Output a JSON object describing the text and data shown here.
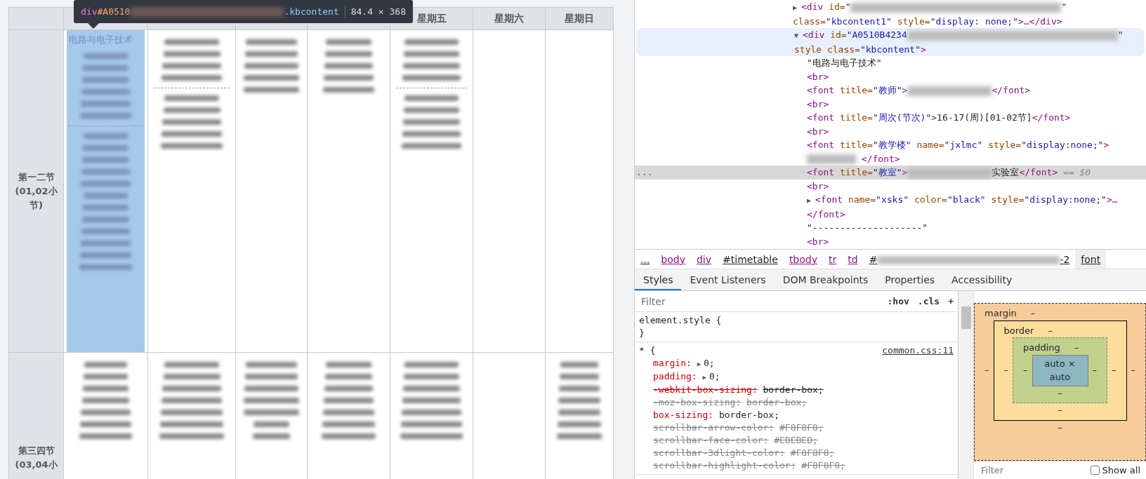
{
  "inspect_tooltip": {
    "tag": "div",
    "id_prefix": "#A0510",
    "class_name": ".kbcontent",
    "size": "84.4 × 368"
  },
  "timetable": {
    "visible_headers": [
      "星期五",
      "星期六",
      "星期日"
    ],
    "rows": [
      {
        "label": "第一二节 (01,02小节)",
        "cells": [
          {
            "kind": "double",
            "title": "电路与电子技术",
            "highlighted": true
          },
          {
            "kind": "double",
            "highlighted": false
          },
          {
            "kind": "course",
            "highlighted": false
          },
          {
            "kind": "course",
            "highlighted": false
          },
          {
            "kind": "double",
            "highlighted": false
          },
          {
            "kind": "empty",
            "highlighted": false
          },
          {
            "kind": "empty",
            "highlighted": false
          }
        ]
      },
      {
        "label": "第三四节 (03,04小",
        "cells": [
          {
            "kind": "course",
            "highlighted": false
          },
          {
            "kind": "course",
            "highlighted": false
          },
          {
            "kind": "course",
            "highlighted": false
          },
          {
            "kind": "course",
            "highlighted": false
          },
          {
            "kind": "course",
            "highlighted": false
          },
          {
            "kind": "empty",
            "highlighted": false
          },
          {
            "kind": "course",
            "highlighted": false
          }
        ]
      }
    ]
  },
  "dom_tree": [
    {
      "toggle": "▶",
      "hovered": false,
      "selected": false,
      "tokens": [
        {
          "kind": "tag",
          "text": "<div"
        },
        {
          "kind": "attr",
          "text": " id="
        },
        {
          "kind": "value",
          "text": "\""
        },
        {
          "kind": "redacted_long"
        },
        {
          "kind": "value",
          "text": "\""
        },
        {
          "kind": "attr",
          "text": " class="
        },
        {
          "kind": "value",
          "text": "\"kbcontent1\""
        },
        {
          "kind": "attr",
          "text": " style="
        },
        {
          "kind": "value",
          "text": "\"display: none;\""
        },
        {
          "kind": "tag",
          "text": ">…</div>"
        }
      ]
    },
    {
      "toggle": "▼",
      "hovered": true,
      "selected": false,
      "tokens": [
        {
          "kind": "tag",
          "text": "<div"
        },
        {
          "kind": "attr",
          "text": " id="
        },
        {
          "kind": "value",
          "text": "\"A0510B4234"
        },
        {
          "kind": "redacted_long"
        },
        {
          "kind": "value",
          "text": "\""
        },
        {
          "kind": "attr",
          "text": " style class="
        },
        {
          "kind": "value",
          "text": "\"kbcontent\""
        },
        {
          "kind": "tag",
          "text": ">"
        }
      ],
      "children": [
        {
          "hovered": false,
          "selected": false,
          "tokens": [
            {
              "kind": "text",
              "text": "\"电路与电子技术\""
            }
          ]
        },
        {
          "hovered": false,
          "selected": false,
          "tokens": [
            {
              "kind": "tag",
              "text": "<br>"
            }
          ]
        },
        {
          "hovered": false,
          "selected": false,
          "tokens": [
            {
              "kind": "tag",
              "text": "<font"
            },
            {
              "kind": "attr",
              "text": " title="
            },
            {
              "kind": "value",
              "text": "\"教师\""
            },
            {
              "kind": "tag",
              "text": ">"
            },
            {
              "kind": "redacted_medium"
            },
            {
              "kind": "tag",
              "text": "</font>"
            }
          ]
        },
        {
          "hovered": false,
          "selected": false,
          "tokens": [
            {
              "kind": "tag",
              "text": "<br>"
            }
          ]
        },
        {
          "hovered": false,
          "selected": false,
          "tokens": [
            {
              "kind": "tag",
              "text": "<font"
            },
            {
              "kind": "attr",
              "text": " title="
            },
            {
              "kind": "value",
              "text": "\"周次(节次)\""
            },
            {
              "kind": "tag",
              "text": ">"
            },
            {
              "kind": "text",
              "text": "16-17(周)[01-02节]"
            },
            {
              "kind": "tag",
              "text": "</font>"
            }
          ]
        },
        {
          "hovered": false,
          "selected": false,
          "tokens": [
            {
              "kind": "tag",
              "text": "<br>"
            }
          ]
        },
        {
          "hovered": false,
          "selected": false,
          "tokens": [
            {
              "kind": "tag",
              "text": "<font"
            },
            {
              "kind": "attr",
              "text": " title="
            },
            {
              "kind": "value",
              "text": "\"教学楼\""
            },
            {
              "kind": "attr",
              "text": " name="
            },
            {
              "kind": "value",
              "text": "\"jxlmc\""
            },
            {
              "kind": "attr",
              "text": " style="
            },
            {
              "kind": "value",
              "text": "\"display:none;\""
            },
            {
              "kind": "tag",
              "text": ">"
            },
            {
              "kind": "redacted_short"
            },
            {
              "kind": "tag",
              "text": " </font>"
            }
          ]
        },
        {
          "hovered": false,
          "selected": true,
          "tokens": [
            {
              "kind": "tag",
              "text": "<font"
            },
            {
              "kind": "attr",
              "text": " title="
            },
            {
              "kind": "value",
              "text": "\"教室\""
            },
            {
              "kind": "tag",
              "text": ">"
            },
            {
              "kind": "redacted_medium"
            },
            {
              "kind": "text",
              "text": "实验室"
            },
            {
              "kind": "tag",
              "text": "</font>"
            },
            {
              "kind": "note",
              "text": " == $0"
            }
          ]
        },
        {
          "hovered": false,
          "selected": false,
          "tokens": [
            {
              "kind": "tag",
              "text": "<br>"
            }
          ]
        },
        {
          "toggle": "▶",
          "hovered": false,
          "selected": false,
          "tokens": [
            {
              "kind": "tag",
              "text": "<font"
            },
            {
              "kind": "attr",
              "text": " name="
            },
            {
              "kind": "value",
              "text": "\"xsks\""
            },
            {
              "kind": "attr",
              "text": " color="
            },
            {
              "kind": "value",
              "text": "\"black\""
            },
            {
              "kind": "attr",
              "text": " style="
            },
            {
              "kind": "value",
              "text": "\"display:none;\""
            },
            {
              "kind": "tag",
              "text": ">…</font>"
            }
          ]
        },
        {
          "hovered": false,
          "selected": false,
          "tokens": [
            {
              "kind": "text",
              "text": "\"--------------------\""
            }
          ]
        },
        {
          "hovered": false,
          "selected": false,
          "tokens": [
            {
              "kind": "tag",
              "text": "<br>"
            }
          ]
        }
      ]
    }
  ],
  "selected_marker": "...",
  "breadcrumbs": [
    {
      "label": "...",
      "kind": "plain",
      "selected": false
    },
    {
      "label": "body",
      "kind": "tag",
      "selected": false
    },
    {
      "label": "div",
      "kind": "tag",
      "selected": false
    },
    {
      "label": "#timetable",
      "kind": "plain",
      "selected": false
    },
    {
      "label": "tbody",
      "kind": "tag",
      "selected": false
    },
    {
      "label": "tr",
      "kind": "tag",
      "selected": false
    },
    {
      "label": "td",
      "kind": "tag",
      "selected": false
    },
    {
      "label": "#",
      "suffix": "-2",
      "kind": "redacted",
      "selected": false
    },
    {
      "label": "font",
      "kind": "plain",
      "selected": true
    }
  ],
  "tabs": [
    {
      "label": "Styles",
      "selected": true
    },
    {
      "label": "Event Listeners",
      "selected": false
    },
    {
      "label": "DOM Breakpoints",
      "selected": false
    },
    {
      "label": "Properties",
      "selected": false
    },
    {
      "label": "Accessibility",
      "selected": false
    }
  ],
  "styles_toolbar": {
    "placeholder": "Filter",
    "buttons": [
      ":hov",
      ".cls",
      "+"
    ]
  },
  "rules": [
    {
      "selector": "element.style {",
      "close": "}"
    },
    {
      "selector": "* {",
      "source": "common.css:11",
      "declarations": [
        {
          "property": "margin:",
          "expand_icon": "▶",
          "value": "0;",
          "kind": "active"
        },
        {
          "property": "padding:",
          "expand_icon": "▶",
          "value": "0;",
          "kind": "active"
        },
        {
          "property": "-webkit-box-sizing:",
          "value": "border-box;",
          "kind": "overridden"
        },
        {
          "property": "-moz-box-sizing:",
          "value": "border-box;",
          "kind": "invalid"
        },
        {
          "property": "box-sizing:",
          "value": "border-box;",
          "kind": "active"
        },
        {
          "property": "scrollbar-arrow-color:",
          "value": "#F8F8F8;",
          "kind": "invalid"
        },
        {
          "property": "scrollbar-face-color:",
          "value": "#EBEBED;",
          "kind": "invalid"
        },
        {
          "property": "scrollbar-3dlight-color:",
          "value": "#F8F8F8;",
          "kind": "invalid"
        },
        {
          "property": "scrollbar-highlight-color:",
          "value": "#F8F8F8;",
          "kind": "invalid"
        }
      ]
    }
  ],
  "box_model": {
    "margin": {
      "label": "margin",
      "top": "–",
      "right": "–",
      "bottom": "–",
      "left": "–"
    },
    "border": {
      "label": "border",
      "top": "–",
      "right": "–",
      "bottom": "–",
      "left": "–"
    },
    "padding": {
      "label": "padding",
      "top": "–",
      "right": "–",
      "bottom": "–",
      "left": "–"
    },
    "content": "auto × auto"
  },
  "computed_footer": {
    "placeholder": "Filter",
    "show_all": {
      "label": "Show all",
      "checked": false
    }
  }
}
